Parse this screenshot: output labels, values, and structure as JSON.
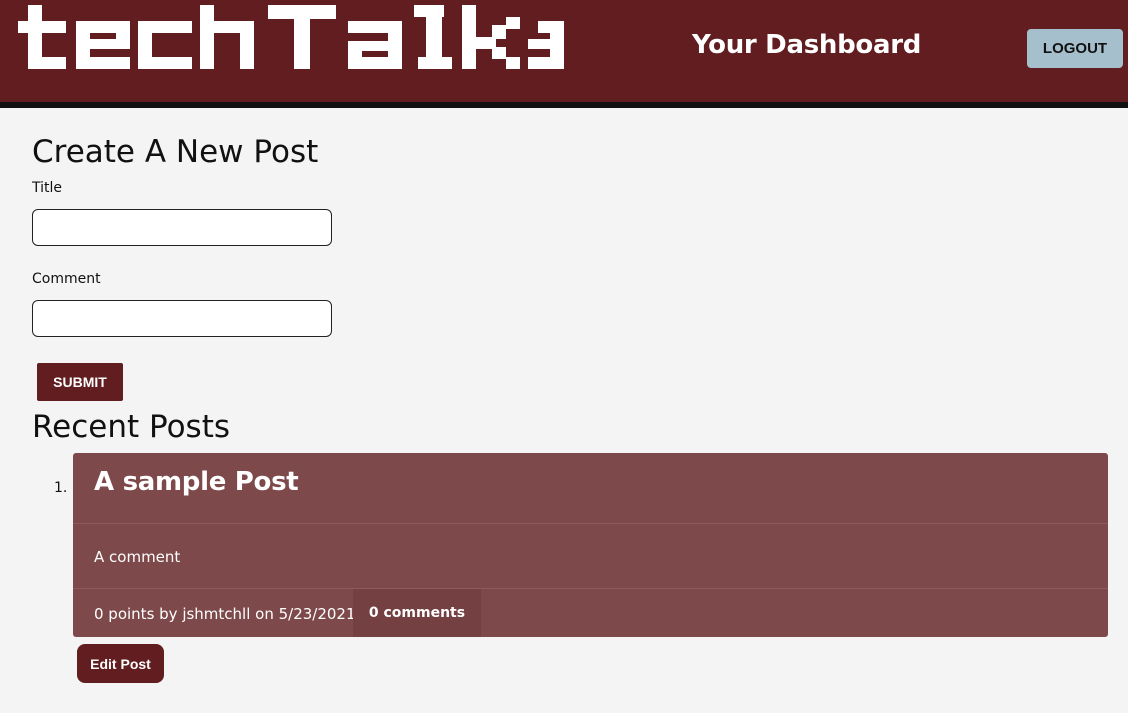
{
  "header": {
    "logo_text": "techTalk",
    "dashboard_title": "Your Dashboard",
    "logout_label": "LOGOUT"
  },
  "create_form": {
    "heading": "Create A New Post",
    "title_label": "Title",
    "title_value": "",
    "comment_label": "Comment",
    "comment_value": "",
    "submit_label": "SUBMIT"
  },
  "recent": {
    "heading": "Recent Posts",
    "posts": [
      {
        "number": "1.",
        "title": "A sample Post",
        "body": "A comment",
        "meta": "0 points by jshmtchll on 5/23/2021",
        "separator": "|",
        "comments_label": "0 comments",
        "edit_label": "Edit Post"
      }
    ]
  },
  "colors": {
    "header_bg": "#611d1f",
    "card_bg": "#7e494a",
    "logout_bg": "#a5bfcd",
    "page_bg": "#f4f4f4"
  }
}
